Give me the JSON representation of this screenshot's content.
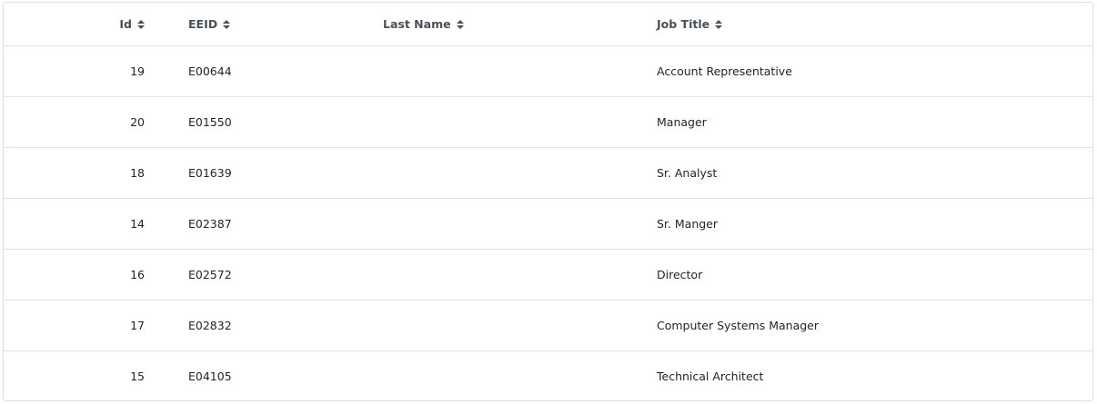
{
  "table": {
    "columns": [
      {
        "label": "Id",
        "key": "id"
      },
      {
        "label": "EEID",
        "key": "eeid"
      },
      {
        "label": "Last Name",
        "key": "last_name"
      },
      {
        "label": "Job Title",
        "key": "job_title"
      }
    ],
    "rows": [
      {
        "id": "19",
        "eeid": "E00644",
        "last_name": "",
        "job_title": "Account Representative"
      },
      {
        "id": "20",
        "eeid": "E01550",
        "last_name": "",
        "job_title": "Manager"
      },
      {
        "id": "18",
        "eeid": "E01639",
        "last_name": "",
        "job_title": "Sr. Analyst"
      },
      {
        "id": "14",
        "eeid": "E02387",
        "last_name": "",
        "job_title": "Sr. Manger"
      },
      {
        "id": "16",
        "eeid": "E02572",
        "last_name": "",
        "job_title": "Director"
      },
      {
        "id": "17",
        "eeid": "E02832",
        "last_name": "",
        "job_title": "Computer Systems Manager"
      },
      {
        "id": "15",
        "eeid": "E04105",
        "last_name": "",
        "job_title": "Technical Architect"
      }
    ]
  }
}
